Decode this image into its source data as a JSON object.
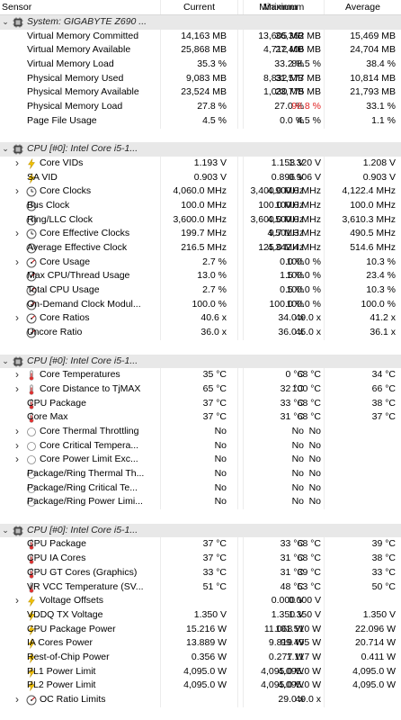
{
  "headers": {
    "sensor": "Sensor",
    "current": "Current",
    "minimum": "Minimum",
    "maximum": "Maximum",
    "average": "Average"
  },
  "rows": [
    {
      "kind": "group",
      "icon": "cpu-chip-icon",
      "name": "System: GIGABYTE Z690 ..."
    },
    {
      "kind": "item",
      "indent": 1,
      "name": "Virtual Memory Committed",
      "cur": "14,163 MB",
      "min": "13,605 MB",
      "max": "36,362 MB",
      "avg": "15,469 MB"
    },
    {
      "kind": "item",
      "indent": 1,
      "name": "Virtual Memory Available",
      "cur": "25,868 MB",
      "min": "4,712 MB",
      "max": "27,406 MB",
      "avg": "24,704 MB"
    },
    {
      "kind": "item",
      "indent": 1,
      "name": "Virtual Memory Load",
      "cur": "35.3 %",
      "min": "33.2 %",
      "max": "88.5 %",
      "avg": "38.4 %"
    },
    {
      "kind": "item",
      "indent": 1,
      "name": "Physical Memory Used",
      "cur": "9,083 MB",
      "min": "8,832 MB",
      "max": "31,577 MB",
      "avg": "10,814 MB"
    },
    {
      "kind": "item",
      "indent": 1,
      "name": "Physical Memory Available",
      "cur": "23,524 MB",
      "min": "1,030 MB",
      "max": "23,775 MB",
      "avg": "21,793 MB"
    },
    {
      "kind": "item",
      "indent": 1,
      "name": "Physical Memory Load",
      "cur": "27.8 %",
      "min": "27.0 %",
      "max": "96.8 %",
      "maxRed": true,
      "avg": "33.1 %"
    },
    {
      "kind": "item",
      "indent": 1,
      "name": "Page File Usage",
      "cur": "4.5 %",
      "min": "0.0 %",
      "max": "4.5 %",
      "avg": "1.1 %"
    },
    {
      "kind": "blank"
    },
    {
      "kind": "group",
      "icon": "cpu-chip-icon",
      "name": "CPU [#0]: Intel Core i5-1..."
    },
    {
      "kind": "item",
      "chev": true,
      "icon": "lightning-icon",
      "name": "Core VIDs",
      "cur": "1.193 V",
      "min": "1.153 V",
      "max": "1.320 V",
      "avg": "1.208 V"
    },
    {
      "kind": "item",
      "icon": "lightning-icon",
      "name": "SA VID",
      "cur": "0.903 V",
      "min": "0.896 V",
      "max": "0.906 V",
      "avg": "0.903 V"
    },
    {
      "kind": "item",
      "chev": true,
      "icon": "clock-icon",
      "name": "Core Clocks",
      "cur": "4,060.0 MHz",
      "min": "3,400.0 MHz",
      "max": "4,900.0 MHz",
      "avg": "4,122.4 MHz"
    },
    {
      "kind": "item",
      "icon": "clock-icon",
      "name": "Bus Clock",
      "cur": "100.0 MHz",
      "min": "100.0 MHz",
      "max": "100.0 MHz",
      "avg": "100.0 MHz"
    },
    {
      "kind": "item",
      "icon": "clock-icon",
      "name": "Ring/LLC Clock",
      "cur": "3,600.0 MHz",
      "min": "3,600.0 MHz",
      "max": "4,500.0 MHz",
      "avg": "3,610.3 MHz"
    },
    {
      "kind": "item",
      "chev": true,
      "icon": "clock-icon",
      "name": "Core Effective Clocks",
      "cur": "199.7 MHz",
      "min": "9.7 MHz",
      "max": "4,501.3 MHz",
      "avg": "490.5 MHz"
    },
    {
      "kind": "item",
      "icon": "clock-icon",
      "name": "Average Effective Clock",
      "cur": "216.5 MHz",
      "min": "125.0 MHz",
      "max": "4,342.4 MHz",
      "avg": "514.6 MHz"
    },
    {
      "kind": "item",
      "chev": true,
      "icon": "gauge-icon",
      "name": "Core Usage",
      "cur": "2.7 %",
      "min": "0.0 %",
      "max": "100.0 %",
      "avg": "10.3 %"
    },
    {
      "kind": "item",
      "icon": "gauge-icon",
      "name": "Max CPU/Thread Usage",
      "cur": "13.0 %",
      "min": "1.5 %",
      "max": "100.0 %",
      "avg": "23.4 %"
    },
    {
      "kind": "item",
      "icon": "gauge-icon",
      "name": "Total CPU Usage",
      "cur": "2.7 %",
      "min": "0.5 %",
      "max": "100.0 %",
      "avg": "10.3 %"
    },
    {
      "kind": "item",
      "icon": "gauge-icon",
      "name": "On-Demand Clock Modul...",
      "cur": "100.0 %",
      "min": "100.0 %",
      "max": "100.0 %",
      "avg": "100.0 %"
    },
    {
      "kind": "item",
      "chev": true,
      "icon": "gauge-icon",
      "name": "Core Ratios",
      "cur": "40.6 x",
      "min": "34.0 x",
      "max": "49.0 x",
      "avg": "41.2 x"
    },
    {
      "kind": "item",
      "icon": "gauge-icon",
      "name": "Uncore Ratio",
      "cur": "36.0 x",
      "min": "36.0 x",
      "max": "45.0 x",
      "avg": "36.1 x"
    },
    {
      "kind": "blank"
    },
    {
      "kind": "group",
      "icon": "cpu-chip-icon",
      "name": "CPU [#0]: Intel Core i5-1..."
    },
    {
      "kind": "item",
      "chev": true,
      "icon": "thermometer-icon",
      "name": "Core Temperatures",
      "cur": "35 °C",
      "min": "0 °C",
      "max": "68 °C",
      "avg": "34 °C"
    },
    {
      "kind": "item",
      "chev": true,
      "icon": "thermometer-icon",
      "name": "Core Distance to TjMAX",
      "cur": "65 °C",
      "min": "32 °C",
      "max": "100 °C",
      "avg": "66 °C"
    },
    {
      "kind": "item",
      "icon": "thermometer-icon",
      "name": "CPU Package",
      "cur": "37 °C",
      "min": "33 °C",
      "max": "68 °C",
      "avg": "38 °C"
    },
    {
      "kind": "item",
      "icon": "thermometer-icon",
      "name": "Core Max",
      "cur": "37 °C",
      "min": "31 °C",
      "max": "68 °C",
      "avg": "37 °C"
    },
    {
      "kind": "item",
      "chev": true,
      "icon": "status-icon",
      "name": "Core Thermal Throttling",
      "cur": "No",
      "min": "No",
      "max": "No",
      "avg": ""
    },
    {
      "kind": "item",
      "chev": true,
      "icon": "status-icon",
      "name": "Core Critical Tempera...",
      "cur": "No",
      "min": "No",
      "max": "No",
      "avg": ""
    },
    {
      "kind": "item",
      "chev": true,
      "icon": "status-icon",
      "name": "Core Power Limit Exc...",
      "cur": "No",
      "min": "No",
      "max": "No",
      "avg": ""
    },
    {
      "kind": "item",
      "icon": "status-icon",
      "name": "Package/Ring Thermal Th...",
      "cur": "No",
      "min": "No",
      "max": "No",
      "avg": ""
    },
    {
      "kind": "item",
      "icon": "status-icon",
      "name": "Package/Ring Critical Te...",
      "cur": "No",
      "min": "No",
      "max": "No",
      "avg": ""
    },
    {
      "kind": "item",
      "icon": "status-icon",
      "name": "Package/Ring Power Limi...",
      "cur": "No",
      "min": "No",
      "max": "No",
      "avg": ""
    },
    {
      "kind": "blank"
    },
    {
      "kind": "group",
      "icon": "cpu-chip-icon",
      "name": "CPU [#0]: Intel Core i5-1..."
    },
    {
      "kind": "item",
      "icon": "thermometer-icon",
      "name": "CPU Package",
      "cur": "37 °C",
      "min": "33 °C",
      "max": "68 °C",
      "avg": "39 °C"
    },
    {
      "kind": "item",
      "icon": "thermometer-icon",
      "name": "CPU IA Cores",
      "cur": "37 °C",
      "min": "31 °C",
      "max": "68 °C",
      "avg": "38 °C"
    },
    {
      "kind": "item",
      "icon": "thermometer-icon",
      "name": "CPU GT Cores (Graphics)",
      "cur": "33 °C",
      "min": "31 °C",
      "max": "39 °C",
      "avg": "33 °C"
    },
    {
      "kind": "item",
      "icon": "thermometer-icon",
      "name": "VR VCC Temperature (SV...",
      "cur": "51 °C",
      "min": "48 °C",
      "max": "53 °C",
      "avg": "50 °C"
    },
    {
      "kind": "item",
      "chev": true,
      "icon": "lightning-icon",
      "name": "Voltage Offsets",
      "cur": "",
      "min": "0.000 V",
      "max": "0.000 V",
      "avg": ""
    },
    {
      "kind": "item",
      "icon": "lightning-icon",
      "name": "VDDQ TX Voltage",
      "cur": "1.350 V",
      "min": "1.350 V",
      "max": "1.350 V",
      "avg": "1.350 V"
    },
    {
      "kind": "item",
      "icon": "lightning-icon",
      "name": "CPU Package Power",
      "cur": "15.216 W",
      "min": "11.068 W",
      "max": "101.510 W",
      "avg": "22.096 W"
    },
    {
      "kind": "item",
      "icon": "lightning-icon",
      "name": "IA Cores Power",
      "cur": "13.889 W",
      "min": "9.819 W",
      "max": "99.495 W",
      "avg": "20.714 W"
    },
    {
      "kind": "item",
      "icon": "lightning-icon",
      "name": "Rest-of-Chip Power",
      "cur": "0.356 W",
      "min": "0.277 W",
      "max": "1.117 W",
      "avg": "0.411 W"
    },
    {
      "kind": "item",
      "icon": "lightning-icon",
      "name": "PL1 Power Limit",
      "cur": "4,095.0 W",
      "min": "4,095.0 W",
      "max": "4,095.0 W",
      "avg": "4,095.0 W"
    },
    {
      "kind": "item",
      "icon": "lightning-icon",
      "name": "PL2 Power Limit",
      "cur": "4,095.0 W",
      "min": "4,095.0 W",
      "max": "4,095.0 W",
      "avg": "4,095.0 W"
    },
    {
      "kind": "item",
      "chev": true,
      "icon": "gauge-icon",
      "name": "OC Ratio Limits",
      "cur": "",
      "min": "29.0 x",
      "max": "49.0 x",
      "avg": ""
    }
  ]
}
